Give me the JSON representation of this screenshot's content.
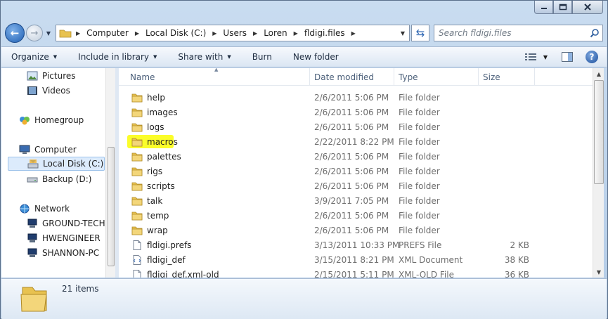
{
  "window": {
    "accent": "#b9cde3"
  },
  "address": {
    "crumbs": [
      "Computer",
      "Local Disk (C:)",
      "Users",
      "Loren",
      "fldigi.files"
    ]
  },
  "search": {
    "placeholder": "Search fldigi.files"
  },
  "toolbar": {
    "organize": "Organize",
    "include_in_library": "Include in library",
    "share_with": "Share with",
    "burn": "Burn",
    "new_folder": "New folder"
  },
  "nav": {
    "items": [
      {
        "label": "Pictures",
        "icon": "pictures-icon"
      },
      {
        "label": "Videos",
        "icon": "videos-icon"
      },
      {
        "label": "Homegroup",
        "icon": "homegroup-icon"
      },
      {
        "label": "Computer",
        "icon": "computer-icon"
      },
      {
        "label": "Local Disk (C:)",
        "icon": "local-disk-icon",
        "selected": true
      },
      {
        "label": "Backup (D:)",
        "icon": "drive-icon"
      },
      {
        "label": "Network",
        "icon": "network-icon"
      },
      {
        "label": "GROUND-TECH",
        "icon": "network-pc-icon"
      },
      {
        "label": "HWENGINEER",
        "icon": "network-pc-icon"
      },
      {
        "label": "SHANNON-PC",
        "icon": "network-pc-icon"
      }
    ]
  },
  "columns": {
    "name": "Name",
    "date": "Date modified",
    "type": "Type",
    "size": "Size"
  },
  "files": [
    {
      "name": "help",
      "date": "2/6/2011 5:06 PM",
      "type": "File folder",
      "size": "",
      "kind": "folder"
    },
    {
      "name": "images",
      "date": "2/6/2011 5:06 PM",
      "type": "File folder",
      "size": "",
      "kind": "folder"
    },
    {
      "name": "logs",
      "date": "2/6/2011 5:06 PM",
      "type": "File folder",
      "size": "",
      "kind": "folder"
    },
    {
      "name": "macros",
      "date": "2/22/2011 8:22 PM",
      "type": "File folder",
      "size": "",
      "kind": "folder",
      "highlight": true
    },
    {
      "name": "palettes",
      "date": "2/6/2011 5:06 PM",
      "type": "File folder",
      "size": "",
      "kind": "folder"
    },
    {
      "name": "rigs",
      "date": "2/6/2011 5:06 PM",
      "type": "File folder",
      "size": "",
      "kind": "folder"
    },
    {
      "name": "scripts",
      "date": "2/6/2011 5:06 PM",
      "type": "File folder",
      "size": "",
      "kind": "folder"
    },
    {
      "name": "talk",
      "date": "3/9/2011 7:05 PM",
      "type": "File folder",
      "size": "",
      "kind": "folder"
    },
    {
      "name": "temp",
      "date": "2/6/2011 5:06 PM",
      "type": "File folder",
      "size": "",
      "kind": "folder"
    },
    {
      "name": "wrap",
      "date": "2/6/2011 5:06 PM",
      "type": "File folder",
      "size": "",
      "kind": "folder"
    },
    {
      "name": "fldigi.prefs",
      "date": "3/13/2011 10:33 PM",
      "type": "PREFS File",
      "size": "2 KB",
      "kind": "file"
    },
    {
      "name": "fldigi_def",
      "date": "3/15/2011 8:21 PM",
      "type": "XML Document",
      "size": "38 KB",
      "kind": "xml"
    },
    {
      "name": "fldigi_def.xml-old",
      "date": "2/15/2011 5:11 PM",
      "type": "XML-OLD File",
      "size": "36 KB",
      "kind": "file"
    }
  ],
  "details": {
    "count": "21 items"
  },
  "colors": {
    "highlight": "#fbfd2a",
    "folder": "#e8c250",
    "selection": "#dcebfc"
  }
}
